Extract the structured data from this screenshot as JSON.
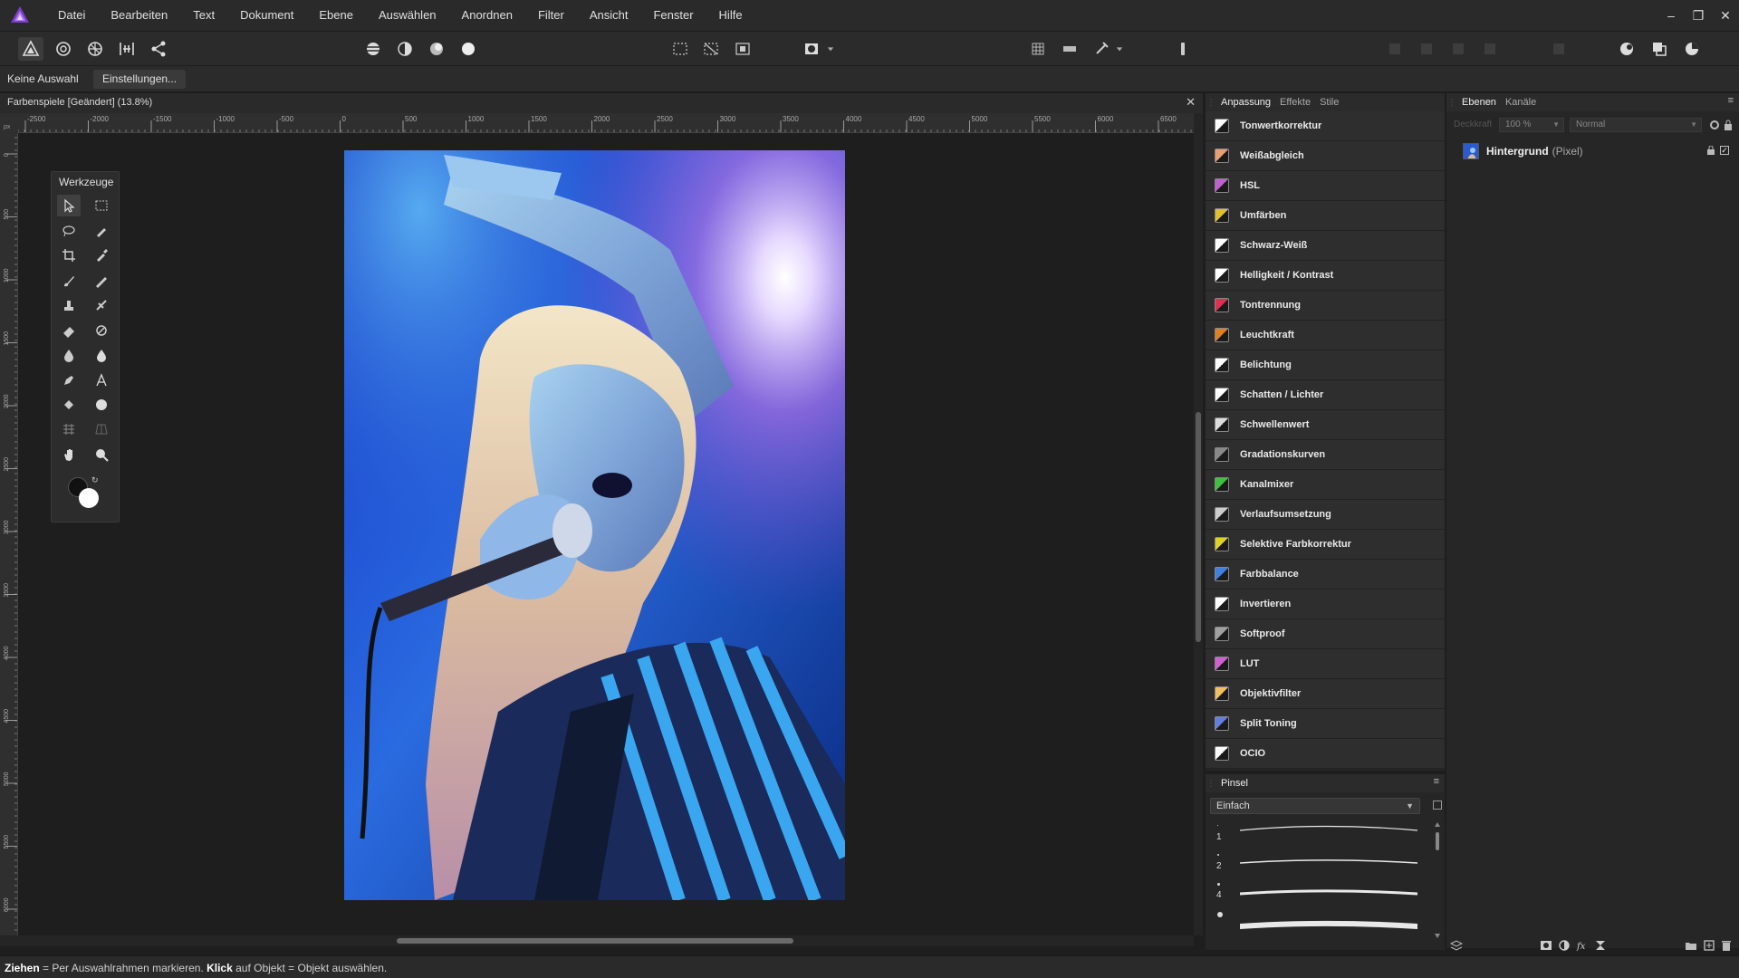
{
  "menubar": {
    "items": [
      "Datei",
      "Bearbeiten",
      "Text",
      "Dokument",
      "Ebene",
      "Auswählen",
      "Anordnen",
      "Filter",
      "Ansicht",
      "Fenster",
      "Hilfe"
    ],
    "window_controls": {
      "minimize": "–",
      "restore": "❐",
      "close": "✕"
    }
  },
  "contextbar": {
    "selection_label": "Keine Auswahl",
    "settings_label": "Einstellungen..."
  },
  "document": {
    "title": "Farbenspiele [Geändert] (13.8%)",
    "close_glyph": "✕"
  },
  "rulers": {
    "top_labels": [
      "-2500",
      "-2000",
      "-1500",
      "-1000",
      "-500",
      "0",
      "500",
      "1000",
      "1500",
      "2000",
      "2500",
      "3000",
      "3500",
      "4000",
      "4500",
      "5000",
      "5500",
      "6000",
      "6500"
    ],
    "left_labels": [
      "0",
      "500",
      "1000",
      "1500",
      "2000",
      "2500",
      "3000",
      "3500",
      "4000",
      "4500",
      "5000",
      "5500",
      "6000"
    ],
    "unit_label": "px"
  },
  "tools": {
    "title": "Werkzeuge"
  },
  "adjustment_panel": {
    "tabs": [
      "Anpassung",
      "Effekte",
      "Stile"
    ],
    "active_tab": "Anpassung",
    "items": [
      {
        "label": "Tonwertkorrektur",
        "icon": "levels-icon"
      },
      {
        "label": "Weißabgleich",
        "icon": "white-balance-icon"
      },
      {
        "label": "HSL",
        "icon": "hsl-icon"
      },
      {
        "label": "Umfärben",
        "icon": "recolor-icon"
      },
      {
        "label": "Schwarz-Weiß",
        "icon": "black-white-icon"
      },
      {
        "label": "Helligkeit / Kontrast",
        "icon": "brightness-contrast-icon"
      },
      {
        "label": "Tontrennung",
        "icon": "posterize-icon"
      },
      {
        "label": "Leuchtkraft",
        "icon": "vibrance-icon"
      },
      {
        "label": "Belichtung",
        "icon": "exposure-icon"
      },
      {
        "label": "Schatten / Lichter",
        "icon": "shadows-highlights-icon"
      },
      {
        "label": "Schwellenwert",
        "icon": "threshold-icon"
      },
      {
        "label": "Gradationskurven",
        "icon": "curves-icon"
      },
      {
        "label": "Kanalmixer",
        "icon": "channel-mixer-icon"
      },
      {
        "label": "Verlaufsumsetzung",
        "icon": "gradient-map-icon"
      },
      {
        "label": "Selektive Farbkorrektur",
        "icon": "selective-color-icon"
      },
      {
        "label": "Farbbalance",
        "icon": "color-balance-icon"
      },
      {
        "label": "Invertieren",
        "icon": "invert-icon"
      },
      {
        "label": "Softproof",
        "icon": "soft-proof-icon"
      },
      {
        "label": "LUT",
        "icon": "lut-icon"
      },
      {
        "label": "Objektivfilter",
        "icon": "lens-filter-icon"
      },
      {
        "label": "Split Toning",
        "icon": "split-toning-icon"
      },
      {
        "label": "OCIO",
        "icon": "ocio-icon"
      }
    ]
  },
  "brush_panel": {
    "tab": "Pinsel",
    "category": "Einfach",
    "brushes": [
      {
        "size": "1"
      },
      {
        "size": "2"
      },
      {
        "size": "4"
      },
      {
        "size": ""
      }
    ]
  },
  "layers_panel": {
    "tabs": [
      "Ebenen",
      "Kanäle"
    ],
    "active_tab": "Ebenen",
    "opacity_label": "Deckkraft",
    "opacity": "100 %",
    "blend_mode": "Normal",
    "layers": [
      {
        "name": "Hintergrund",
        "type": "(Pixel)",
        "visible_check": "✓"
      }
    ]
  },
  "statusbar": {
    "drag_key": "Ziehen",
    "drag_text": " = Per Auswahlrahmen markieren. ",
    "click_key": "Klick",
    "click_text": " auf Objekt = Objekt auswählen."
  },
  "colors": {
    "adjust_icons": {
      "levels-icon": "#ffffff",
      "white-balance-icon": "#e8a070",
      "hsl-icon": "#c060d0",
      "recolor-icon": "#e0c030",
      "black-white-icon": "#ffffff",
      "brightness-contrast-icon": "#ffffff",
      "posterize-icon": "#e03050",
      "vibrance-icon": "#e08020",
      "exposure-icon": "#ffffff",
      "shadows-highlights-icon": "#ffffff",
      "threshold-icon": "#dddddd",
      "curves-icon": "#888888",
      "channel-mixer-icon": "#40c040",
      "gradient-map-icon": "#cccccc",
      "selective-color-icon": "#e0d020",
      "color-balance-icon": "#4080e0",
      "invert-icon": "#ffffff",
      "soft-proof-icon": "#a0a0a0",
      "lut-icon": "#d060d0",
      "lens-filter-icon": "#f0c060",
      "split-toning-icon": "#6080e0",
      "ocio-icon": "#ffffff"
    }
  }
}
